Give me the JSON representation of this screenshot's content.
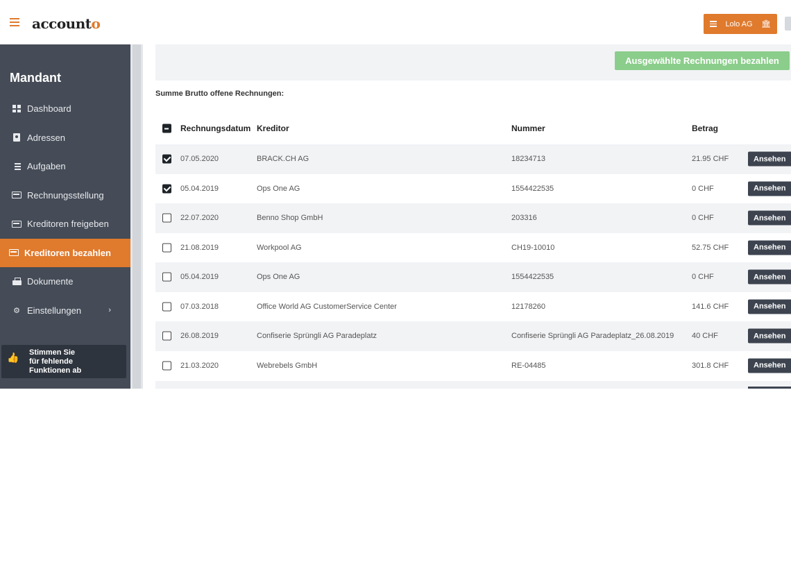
{
  "app": {
    "logo_main": "account",
    "logo_accent": "o"
  },
  "header": {
    "tenant_label": "Lolo AG"
  },
  "sidebar": {
    "title": "Mandant",
    "items": [
      {
        "label": "Dashboard",
        "icon": "dashboard-icon"
      },
      {
        "label": "Adressen",
        "icon": "address-book-icon"
      },
      {
        "label": "Aufgaben",
        "icon": "tasks-icon"
      },
      {
        "label": "Rechnungsstellung",
        "icon": "invoice-icon"
      },
      {
        "label": "Kreditoren freigeben",
        "icon": "invoice-icon"
      },
      {
        "label": "Kreditoren bezahlen",
        "icon": "invoice-icon",
        "active": true
      },
      {
        "label": "Dokumente",
        "icon": "printer-icon"
      },
      {
        "label": "Einstellungen",
        "icon": "gear-icon"
      }
    ],
    "vote_text_1": "Stimmen Sie",
    "vote_text_2": "für fehlende",
    "vote_text_3": "Funktionen ab"
  },
  "main": {
    "pay_button_label": "Ausgewählte Rechnungen bezahlen",
    "sum_label": "Summe Brutto offene Rechnungen:",
    "columns": {
      "date": "Rechnungsdatum",
      "creditor": "Kreditor",
      "number": "Nummer",
      "amount": "Betrag"
    },
    "view_label": "Ansehen",
    "rows": [
      {
        "checked": true,
        "date": "07.05.2020",
        "creditor": "BRACK.CH AG",
        "number": "18234713",
        "amount": "21.95 CHF"
      },
      {
        "checked": true,
        "date": "05.04.2019",
        "creditor": "Ops One AG",
        "number": "1554422535",
        "amount": "0 CHF"
      },
      {
        "checked": false,
        "date": "22.07.2020",
        "creditor": "Benno Shop GmbH",
        "number": "203316",
        "amount": "0 CHF"
      },
      {
        "checked": false,
        "date": "21.08.2019",
        "creditor": "Workpool AG",
        "number": "CH19-10010",
        "amount": "52.75 CHF"
      },
      {
        "checked": false,
        "date": "05.04.2019",
        "creditor": "Ops One AG",
        "number": "1554422535",
        "amount": "0 CHF"
      },
      {
        "checked": false,
        "date": "07.03.2018",
        "creditor": "Office World AG CustomerService Center",
        "number": "12178260",
        "amount": "141.6 CHF"
      },
      {
        "checked": false,
        "date": "26.08.2019",
        "creditor": "Confiserie Sprüngli AG Paradeplatz",
        "number": "Confiserie Sprüngli AG Paradeplatz_26.08.2019",
        "amount": "40 CHF"
      },
      {
        "checked": false,
        "date": "21.03.2020",
        "creditor": "Webrebels GmbH",
        "number": "RE-04485",
        "amount": "301.8 CHF"
      }
    ]
  },
  "colors": {
    "accent": "#e07a2d",
    "sidebar_bg": "#454c57",
    "pay_button": "#8bcd8b",
    "view_button": "#3d4450"
  }
}
